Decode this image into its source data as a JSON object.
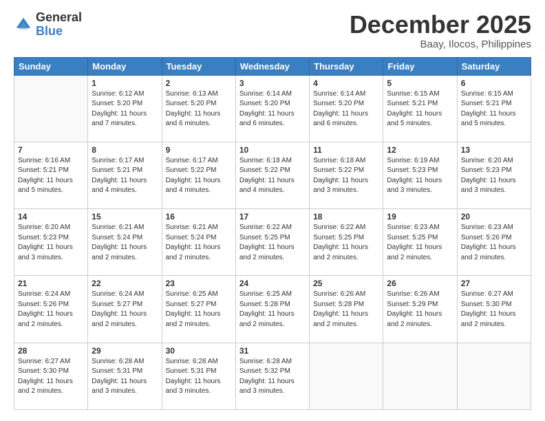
{
  "header": {
    "logo_general": "General",
    "logo_blue": "Blue",
    "month_title": "December 2025",
    "location": "Baay, Ilocos, Philippines"
  },
  "days_of_week": [
    "Sunday",
    "Monday",
    "Tuesday",
    "Wednesday",
    "Thursday",
    "Friday",
    "Saturday"
  ],
  "weeks": [
    [
      {
        "day": "",
        "info": ""
      },
      {
        "day": "1",
        "info": "Sunrise: 6:12 AM\nSunset: 5:20 PM\nDaylight: 11 hours\nand 7 minutes."
      },
      {
        "day": "2",
        "info": "Sunrise: 6:13 AM\nSunset: 5:20 PM\nDaylight: 11 hours\nand 6 minutes."
      },
      {
        "day": "3",
        "info": "Sunrise: 6:14 AM\nSunset: 5:20 PM\nDaylight: 11 hours\nand 6 minutes."
      },
      {
        "day": "4",
        "info": "Sunrise: 6:14 AM\nSunset: 5:20 PM\nDaylight: 11 hours\nand 6 minutes."
      },
      {
        "day": "5",
        "info": "Sunrise: 6:15 AM\nSunset: 5:21 PM\nDaylight: 11 hours\nand 5 minutes."
      },
      {
        "day": "6",
        "info": "Sunrise: 6:15 AM\nSunset: 5:21 PM\nDaylight: 11 hours\nand 5 minutes."
      }
    ],
    [
      {
        "day": "7",
        "info": "Sunrise: 6:16 AM\nSunset: 5:21 PM\nDaylight: 11 hours\nand 5 minutes."
      },
      {
        "day": "8",
        "info": "Sunrise: 6:17 AM\nSunset: 5:21 PM\nDaylight: 11 hours\nand 4 minutes."
      },
      {
        "day": "9",
        "info": "Sunrise: 6:17 AM\nSunset: 5:22 PM\nDaylight: 11 hours\nand 4 minutes."
      },
      {
        "day": "10",
        "info": "Sunrise: 6:18 AM\nSunset: 5:22 PM\nDaylight: 11 hours\nand 4 minutes."
      },
      {
        "day": "11",
        "info": "Sunrise: 6:18 AM\nSunset: 5:22 PM\nDaylight: 11 hours\nand 3 minutes."
      },
      {
        "day": "12",
        "info": "Sunrise: 6:19 AM\nSunset: 5:23 PM\nDaylight: 11 hours\nand 3 minutes."
      },
      {
        "day": "13",
        "info": "Sunrise: 6:20 AM\nSunset: 5:23 PM\nDaylight: 11 hours\nand 3 minutes."
      }
    ],
    [
      {
        "day": "14",
        "info": "Sunrise: 6:20 AM\nSunset: 5:23 PM\nDaylight: 11 hours\nand 3 minutes."
      },
      {
        "day": "15",
        "info": "Sunrise: 6:21 AM\nSunset: 5:24 PM\nDaylight: 11 hours\nand 2 minutes."
      },
      {
        "day": "16",
        "info": "Sunrise: 6:21 AM\nSunset: 5:24 PM\nDaylight: 11 hours\nand 2 minutes."
      },
      {
        "day": "17",
        "info": "Sunrise: 6:22 AM\nSunset: 5:25 PM\nDaylight: 11 hours\nand 2 minutes."
      },
      {
        "day": "18",
        "info": "Sunrise: 6:22 AM\nSunset: 5:25 PM\nDaylight: 11 hours\nand 2 minutes."
      },
      {
        "day": "19",
        "info": "Sunrise: 6:23 AM\nSunset: 5:25 PM\nDaylight: 11 hours\nand 2 minutes."
      },
      {
        "day": "20",
        "info": "Sunrise: 6:23 AM\nSunset: 5:26 PM\nDaylight: 11 hours\nand 2 minutes."
      }
    ],
    [
      {
        "day": "21",
        "info": "Sunrise: 6:24 AM\nSunset: 5:26 PM\nDaylight: 11 hours\nand 2 minutes."
      },
      {
        "day": "22",
        "info": "Sunrise: 6:24 AM\nSunset: 5:27 PM\nDaylight: 11 hours\nand 2 minutes."
      },
      {
        "day": "23",
        "info": "Sunrise: 6:25 AM\nSunset: 5:27 PM\nDaylight: 11 hours\nand 2 minutes."
      },
      {
        "day": "24",
        "info": "Sunrise: 6:25 AM\nSunset: 5:28 PM\nDaylight: 11 hours\nand 2 minutes."
      },
      {
        "day": "25",
        "info": "Sunrise: 6:26 AM\nSunset: 5:28 PM\nDaylight: 11 hours\nand 2 minutes."
      },
      {
        "day": "26",
        "info": "Sunrise: 6:26 AM\nSunset: 5:29 PM\nDaylight: 11 hours\nand 2 minutes."
      },
      {
        "day": "27",
        "info": "Sunrise: 6:27 AM\nSunset: 5:30 PM\nDaylight: 11 hours\nand 2 minutes."
      }
    ],
    [
      {
        "day": "28",
        "info": "Sunrise: 6:27 AM\nSunset: 5:30 PM\nDaylight: 11 hours\nand 2 minutes."
      },
      {
        "day": "29",
        "info": "Sunrise: 6:28 AM\nSunset: 5:31 PM\nDaylight: 11 hours\nand 3 minutes."
      },
      {
        "day": "30",
        "info": "Sunrise: 6:28 AM\nSunset: 5:31 PM\nDaylight: 11 hours\nand 3 minutes."
      },
      {
        "day": "31",
        "info": "Sunrise: 6:28 AM\nSunset: 5:32 PM\nDaylight: 11 hours\nand 3 minutes."
      },
      {
        "day": "",
        "info": ""
      },
      {
        "day": "",
        "info": ""
      },
      {
        "day": "",
        "info": ""
      }
    ]
  ]
}
